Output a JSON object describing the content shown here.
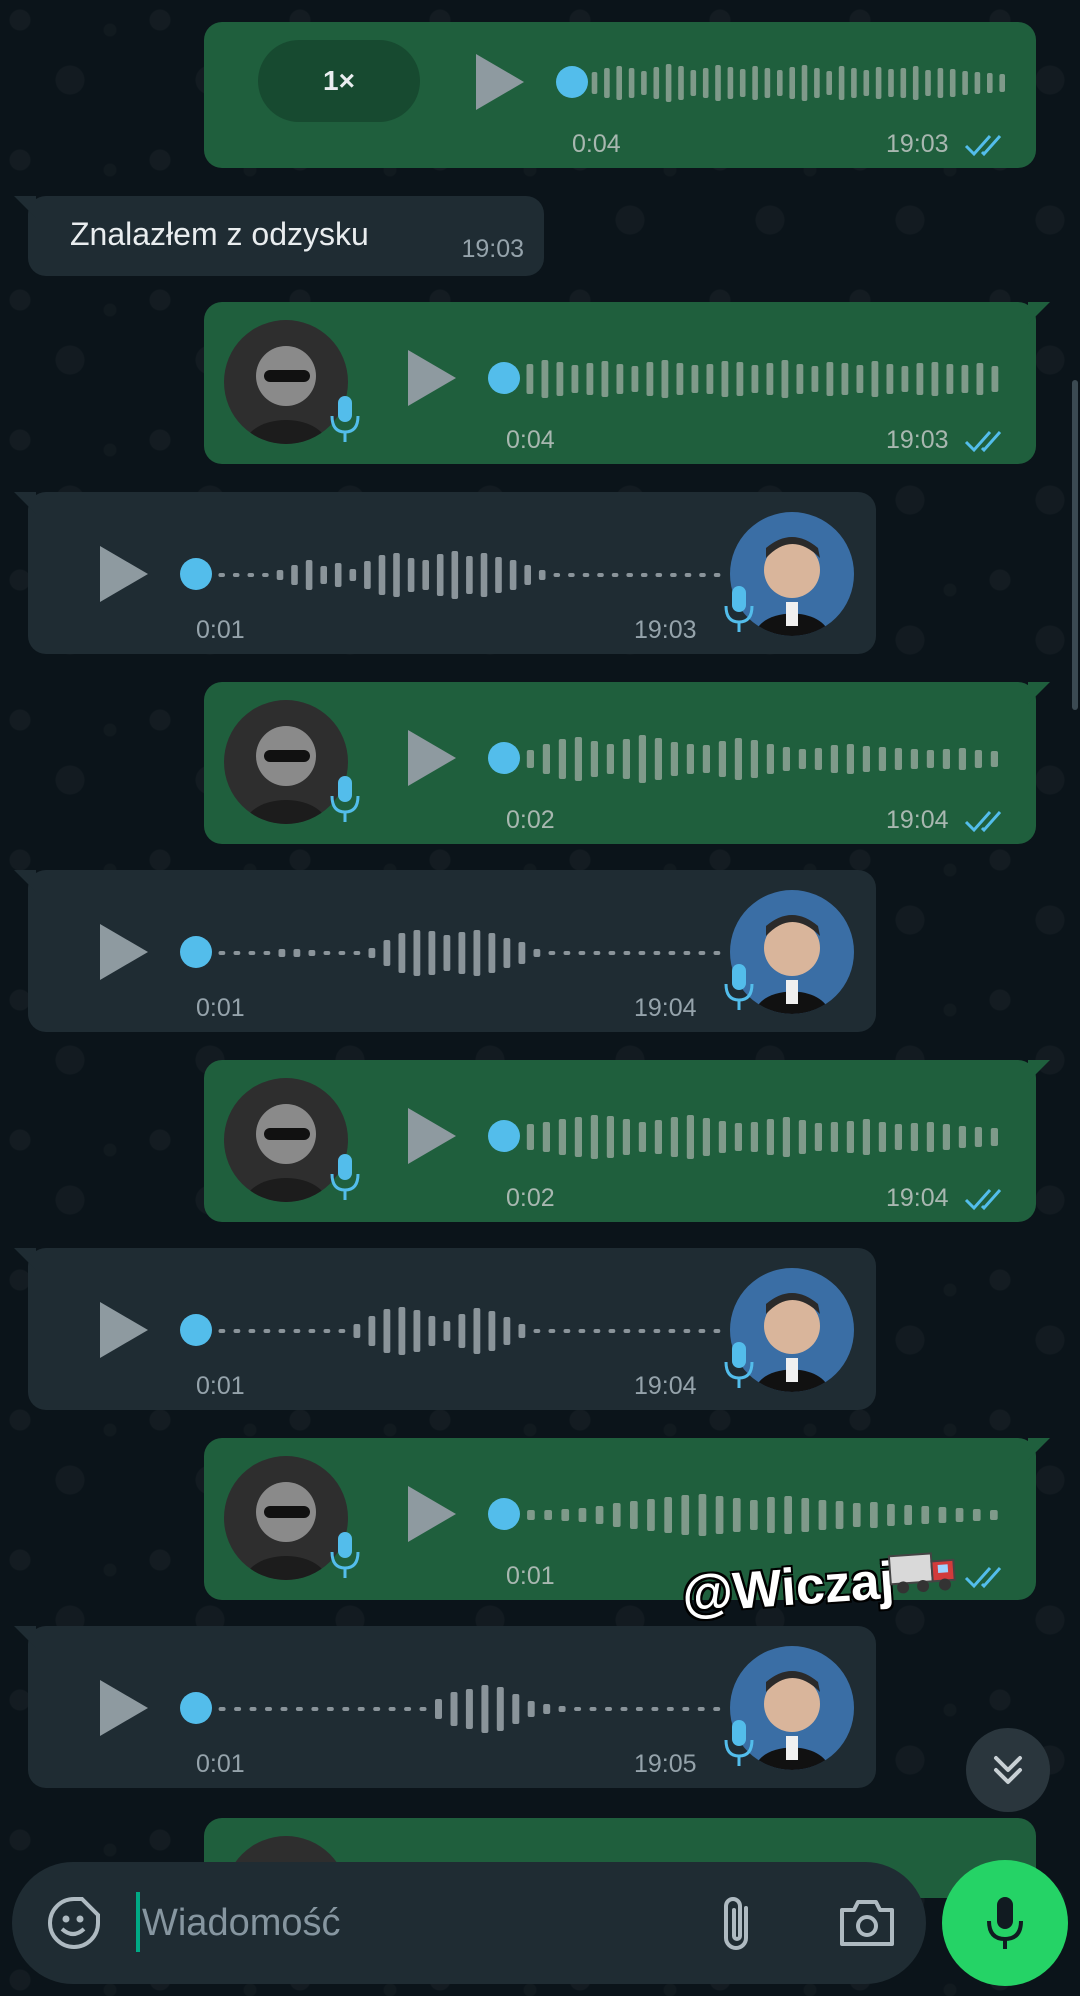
{
  "chat": {
    "messages": [
      {
        "type": "voice",
        "dir": "out",
        "speed": "1×",
        "duration": "0:04",
        "time": "19:03",
        "read": true
      },
      {
        "type": "text",
        "dir": "in",
        "text": "Znalazłem z odzysku",
        "time": "19:03"
      },
      {
        "type": "voice",
        "dir": "out",
        "duration": "0:04",
        "time": "19:03",
        "read": true
      },
      {
        "type": "voice",
        "dir": "in",
        "duration": "0:01",
        "time": "19:03"
      },
      {
        "type": "voice",
        "dir": "out",
        "duration": "0:02",
        "time": "19:04",
        "read": true
      },
      {
        "type": "voice",
        "dir": "in",
        "duration": "0:01",
        "time": "19:04"
      },
      {
        "type": "voice",
        "dir": "out",
        "duration": "0:02",
        "time": "19:04",
        "read": true
      },
      {
        "type": "voice",
        "dir": "in",
        "duration": "0:01",
        "time": "19:04"
      },
      {
        "type": "voice",
        "dir": "out",
        "duration": "0:01",
        "time": "",
        "read": true
      },
      {
        "type": "voice",
        "dir": "in",
        "duration": "0:01",
        "time": "19:05"
      }
    ]
  },
  "overlay": {
    "watermark": "@Wiczaj"
  },
  "composer": {
    "placeholder": "Wiadomość"
  },
  "icons": {
    "play": "play-icon",
    "mic": "microphone-icon",
    "ticks": "double-check-icon",
    "emoji": "sticker-icon",
    "attach": "paperclip-icon",
    "camera": "camera-icon",
    "scroll": "chevrons-down-icon"
  },
  "colors": {
    "outgoing_bubble": "#1f5f3d",
    "incoming_bubble": "#1f2c33",
    "accent_blue": "#53bdeb",
    "fab_green": "#25d366",
    "background": "#0b141a"
  }
}
